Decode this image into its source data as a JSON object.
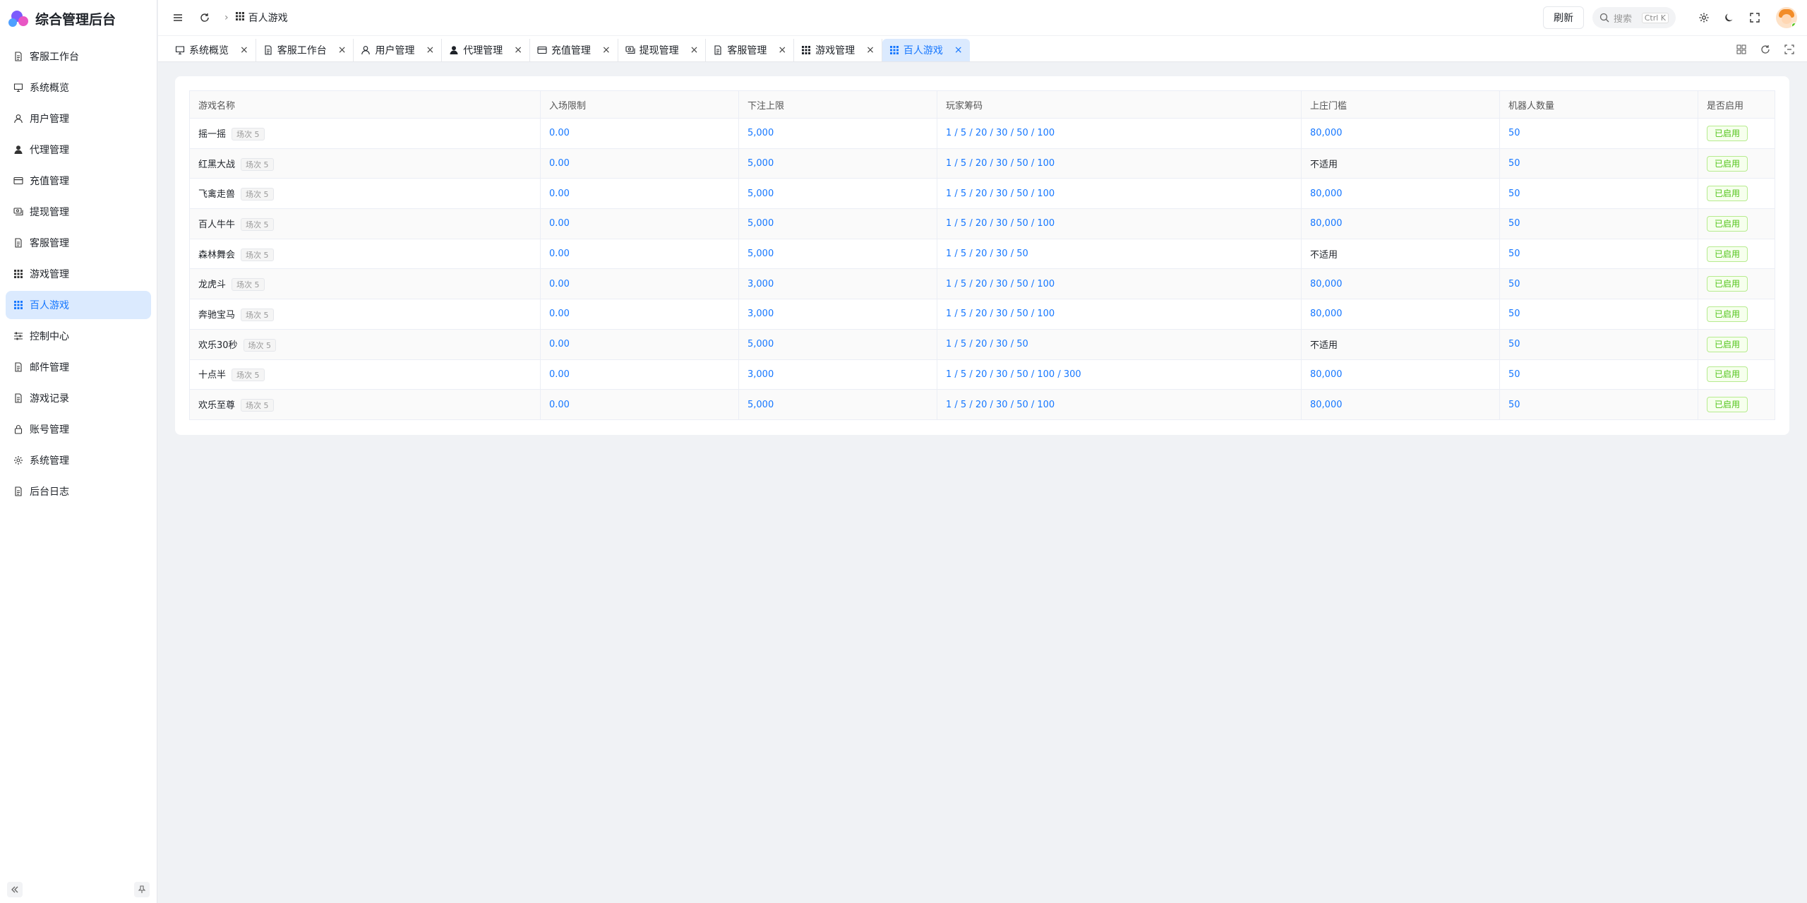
{
  "app": {
    "title": "综合管理后台"
  },
  "sidebar": {
    "items": [
      {
        "label": "客服工作台",
        "icon": "document-icon",
        "active": false
      },
      {
        "label": "系统概览",
        "icon": "monitor-icon",
        "active": false
      },
      {
        "label": "用户管理",
        "icon": "user-icon",
        "active": false
      },
      {
        "label": "代理管理",
        "icon": "user-filled-icon",
        "active": false
      },
      {
        "label": "充值管理",
        "icon": "card-icon",
        "active": false
      },
      {
        "label": "提现管理",
        "icon": "money-icon",
        "active": false
      },
      {
        "label": "客服管理",
        "icon": "document-icon",
        "active": false
      },
      {
        "label": "游戏管理",
        "icon": "grid-icon",
        "active": false
      },
      {
        "label": "百人游戏",
        "icon": "grid-icon",
        "active": true
      },
      {
        "label": "控制中心",
        "icon": "sliders-icon",
        "active": false
      },
      {
        "label": "邮件管理",
        "icon": "document-icon",
        "active": false
      },
      {
        "label": "游戏记录",
        "icon": "document-icon",
        "active": false
      },
      {
        "label": "账号管理",
        "icon": "lock-icon",
        "active": false
      },
      {
        "label": "系统管理",
        "icon": "gear-icon",
        "active": false
      },
      {
        "label": "后台日志",
        "icon": "document-icon",
        "active": false
      }
    ]
  },
  "header": {
    "breadcrumb": "百人游戏",
    "refresh_label": "刷新",
    "search_placeholder": "搜索",
    "search_shortcut": "Ctrl K"
  },
  "tabs": [
    {
      "label": "系统概览",
      "icon": "monitor-icon",
      "active": false
    },
    {
      "label": "客服工作台",
      "icon": "document-icon",
      "active": false
    },
    {
      "label": "用户管理",
      "icon": "user-icon",
      "active": false
    },
    {
      "label": "代理管理",
      "icon": "user-filled-icon",
      "active": false
    },
    {
      "label": "充值管理",
      "icon": "card-icon",
      "active": false
    },
    {
      "label": "提现管理",
      "icon": "money-icon",
      "active": false
    },
    {
      "label": "客服管理",
      "icon": "document-icon",
      "active": false
    },
    {
      "label": "游戏管理",
      "icon": "grid-icon",
      "active": false
    },
    {
      "label": "百人游戏",
      "icon": "grid-icon",
      "active": true
    }
  ],
  "table": {
    "columns": [
      "游戏名称",
      "入场限制",
      "下注上限",
      "玩家筹码",
      "上庄门槛",
      "机器人数量",
      "是否启用"
    ],
    "rows": [
      {
        "name": "摇一摇",
        "count": "场次 5",
        "entry": "0.00",
        "bet_limit": "5,000",
        "chips": "1 / 5 / 20 / 30 / 50 / 100",
        "banker": "80,000",
        "banker_applicable": true,
        "robots": "50",
        "status": "已启用"
      },
      {
        "name": "红黑大战",
        "count": "场次 5",
        "entry": "0.00",
        "bet_limit": "5,000",
        "chips": "1 / 5 / 20 / 30 / 50 / 100",
        "banker": "不适用",
        "banker_applicable": false,
        "robots": "50",
        "status": "已启用"
      },
      {
        "name": "飞禽走兽",
        "count": "场次 5",
        "entry": "0.00",
        "bet_limit": "5,000",
        "chips": "1 / 5 / 20 / 30 / 50 / 100",
        "banker": "80,000",
        "banker_applicable": true,
        "robots": "50",
        "status": "已启用"
      },
      {
        "name": "百人牛牛",
        "count": "场次 5",
        "entry": "0.00",
        "bet_limit": "5,000",
        "chips": "1 / 5 / 20 / 30 / 50 / 100",
        "banker": "80,000",
        "banker_applicable": true,
        "robots": "50",
        "status": "已启用"
      },
      {
        "name": "森林舞会",
        "count": "场次 5",
        "entry": "0.00",
        "bet_limit": "5,000",
        "chips": "1 / 5 / 20 / 30 / 50",
        "banker": "不适用",
        "banker_applicable": false,
        "robots": "50",
        "status": "已启用"
      },
      {
        "name": "龙虎斗",
        "count": "场次 5",
        "entry": "0.00",
        "bet_limit": "3,000",
        "chips": "1 / 5 / 20 / 30 / 50 / 100",
        "banker": "80,000",
        "banker_applicable": true,
        "robots": "50",
        "status": "已启用"
      },
      {
        "name": "奔驰宝马",
        "count": "场次 5",
        "entry": "0.00",
        "bet_limit": "3,000",
        "chips": "1 / 5 / 20 / 30 / 50 / 100",
        "banker": "80,000",
        "banker_applicable": true,
        "robots": "50",
        "status": "已启用"
      },
      {
        "name": "欢乐30秒",
        "count": "场次 5",
        "entry": "0.00",
        "bet_limit": "5,000",
        "chips": "1 / 5 / 20 / 30 / 50",
        "banker": "不适用",
        "banker_applicable": false,
        "robots": "50",
        "status": "已启用"
      },
      {
        "name": "十点半",
        "count": "场次 5",
        "entry": "0.00",
        "bet_limit": "3,000",
        "chips": "1 / 5 / 20 / 30 / 50 / 100 / 300",
        "banker": "80,000",
        "banker_applicable": true,
        "robots": "50",
        "status": "已启用"
      },
      {
        "name": "欢乐至尊",
        "count": "场次 5",
        "entry": "0.00",
        "bet_limit": "5,000",
        "chips": "1 / 5 / 20 / 30 / 50 / 100",
        "banker": "80,000",
        "banker_applicable": true,
        "robots": "50",
        "status": "已启用"
      }
    ]
  },
  "colors": {
    "accent": "#1677ff",
    "active_bg": "#dbeafe",
    "success": "#52c41a"
  }
}
